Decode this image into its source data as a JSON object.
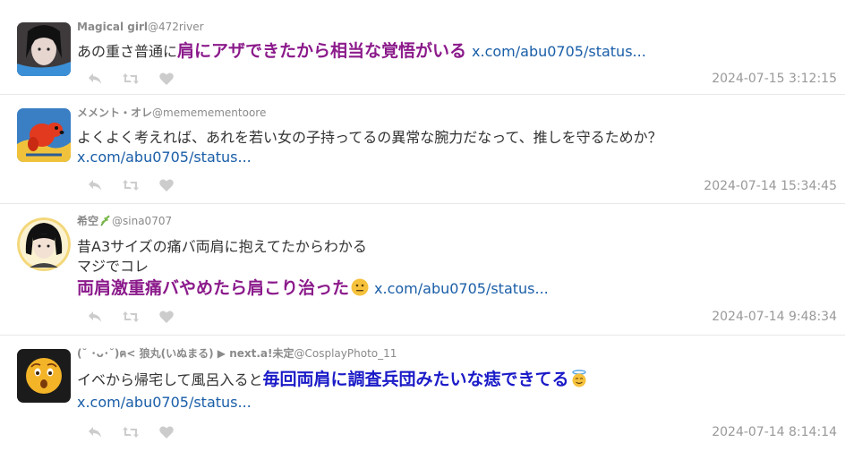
{
  "tweets": [
    {
      "name": "Magical girl",
      "handle": "@472river",
      "text": "あの重さ普通に",
      "highlight": "肩にアザできたから相当な覚悟がいる",
      "link": "x.com/abu0705/status...",
      "timestamp": "2024-07-15 3:12:15",
      "icons": [
        "reply-icon",
        "retweet-icon",
        "like-icon"
      ]
    },
    {
      "name": "メメント・オレ",
      "handle": "@mememementoore",
      "text": "よくよく考えれば、あれを若い女の子持ってるの異常な腕力だなって、推しを守るためか？",
      "link": "x.com/abu0705/status...",
      "timestamp": "2024-07-14 15:34:45",
      "icons": [
        "reply-icon",
        "retweet-icon",
        "like-icon"
      ]
    },
    {
      "name": "希空",
      "name_emoji": "herb-emoji",
      "handle": "@sina0707",
      "text_line1": "昔A3サイズの痛バ両肩に抱えてたからわかる",
      "text_line2": "マジでコレ",
      "highlight": "両肩激重痛バやめたら肩こり治った",
      "highlight_emoji": "neutral-face-emoji",
      "link": "x.com/abu0705/status...",
      "timestamp": "2024-07-14 9:48:34",
      "icons": [
        "reply-icon",
        "retweet-icon",
        "like-icon"
      ]
    },
    {
      "name": "(˘ ･ᴗ･˘)ฅ< 狼丸(いぬまる) ▶ next.a!未定",
      "handle": "@CosplayPhoto_11",
      "text": "イベから帰宅して風呂入ると",
      "highlight": "毎回両肩に調査兵団みたいな痣できてる",
      "highlight_emoji": "smiling-face-with-halo-emoji",
      "link": "x.com/abu0705/status...",
      "timestamp": "2024-07-14 8:14:14",
      "icons": [
        "reply-icon",
        "retweet-icon",
        "like-icon"
      ]
    }
  ],
  "colors": {
    "highlight_purple": "#8b1a8b",
    "highlight_blue": "#1a1ac8",
    "link": "#1a5ea8",
    "meta": "#999999",
    "icon": "#cccccc"
  }
}
